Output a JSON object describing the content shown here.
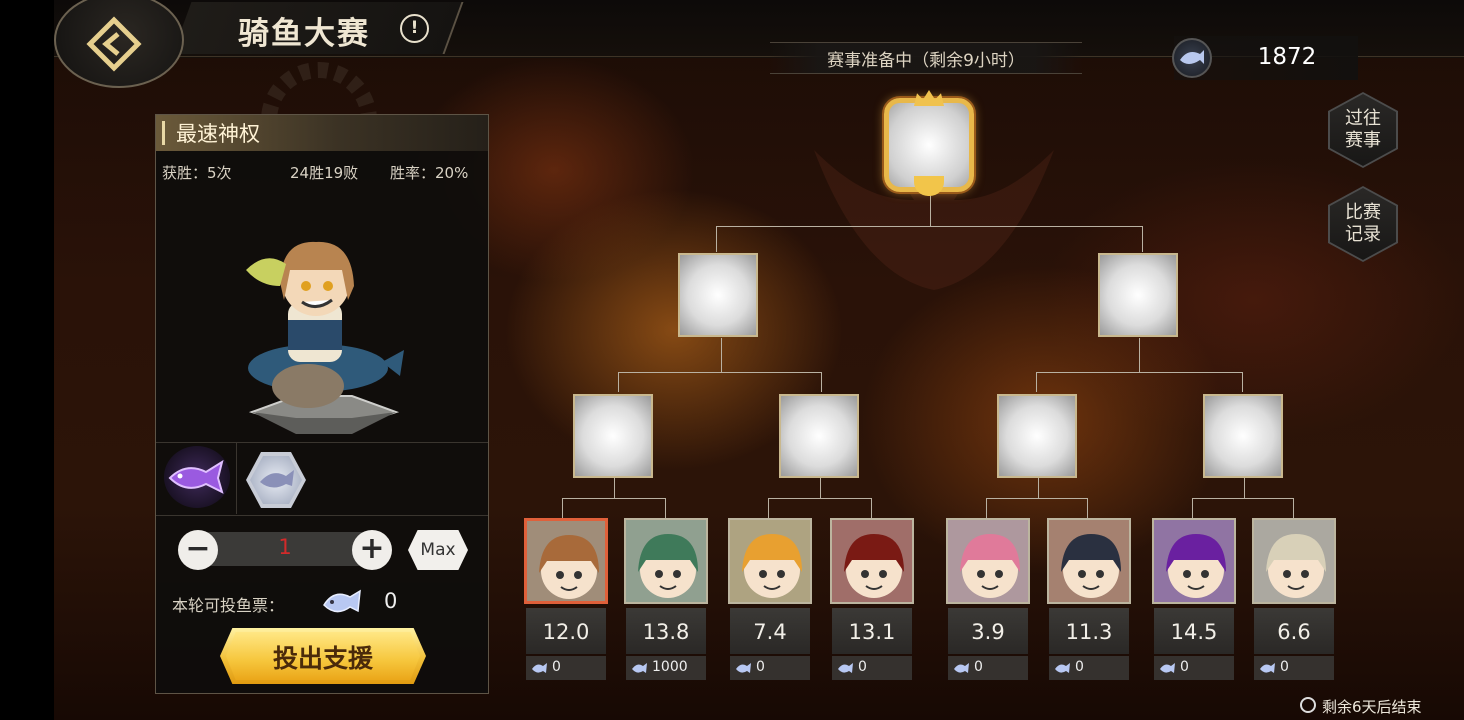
{
  "header": {
    "title": "骑鱼大赛",
    "info_glyph": "!"
  },
  "status": {
    "text": "赛事准备中（剩余9小时）"
  },
  "currency": {
    "amount": "1872",
    "icon": "fish-ticket-icon"
  },
  "side_buttons": [
    {
      "label": "过往\n赛事"
    },
    {
      "label": "比赛\n记录"
    }
  ],
  "entrant": {
    "name": "最速神权",
    "wins": "获胜：5次",
    "record": "24胜19败",
    "win_rate": "胜率：20%"
  },
  "items": [
    {
      "icon": "purple-fish-icon"
    },
    {
      "icon": "silver-fish-badge-icon"
    }
  ],
  "bet": {
    "quantity": "1",
    "minus": "−",
    "plus": "+",
    "max_label": "Max",
    "votes_label": "本轮可投鱼票：",
    "votes_count": "0",
    "support_label": "投出支援"
  },
  "contestants": [
    {
      "odds": "12.0",
      "fans": "0",
      "selected": true,
      "color": "#c8925a",
      "hair": "#a86a3a"
    },
    {
      "odds": "13.8",
      "fans": "1000",
      "selected": false,
      "color": "#9cc89a",
      "hair": "#3f7a5a"
    },
    {
      "odds": "7.4",
      "fans": "0",
      "selected": false,
      "color": "#f0d070",
      "hair": "#e8a030"
    },
    {
      "odds": "13.1",
      "fans": "0",
      "selected": false,
      "color": "#c83a2a",
      "hair": "#7a1a14"
    },
    {
      "odds": "3.9",
      "fans": "0",
      "selected": false,
      "color": "#f2b2c4",
      "hair": "#e07a9a"
    },
    {
      "odds": "11.3",
      "fans": "0",
      "selected": false,
      "color": "#d87040",
      "hair": "#2a3040"
    },
    {
      "odds": "14.5",
      "fans": "0",
      "selected": false,
      "color": "#9a4ad0",
      "hair": "#6a20a0"
    },
    {
      "odds": "6.6",
      "fans": "0",
      "selected": false,
      "color": "#e8e0c8",
      "hair": "#d8d0b8"
    }
  ],
  "footer": {
    "end_text": "剩余6天后结束"
  },
  "colors": {
    "accent_gold": "#f2c13a",
    "selected_border": "#e0603a",
    "qty_red": "#d32a2a"
  }
}
